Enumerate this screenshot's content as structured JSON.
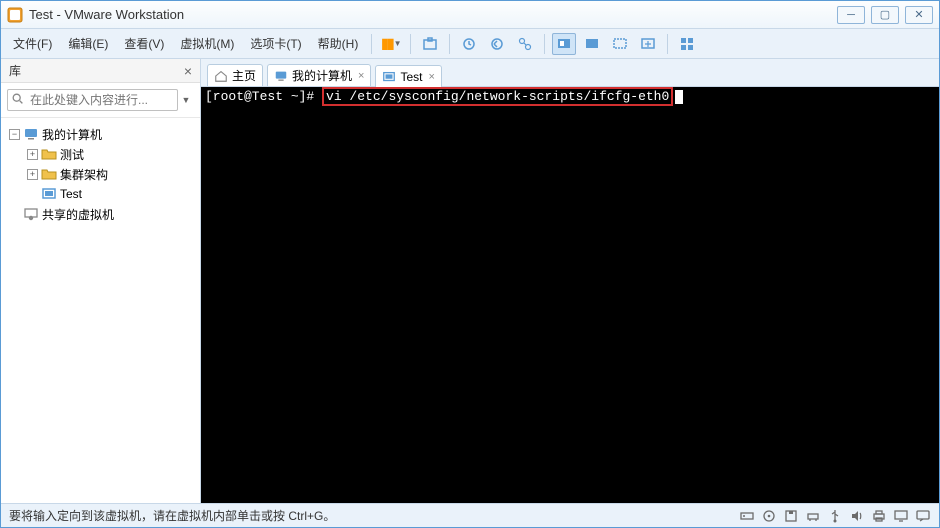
{
  "window": {
    "title": "Test - VMware Workstation"
  },
  "menu": {
    "file": "文件(F)",
    "edit": "编辑(E)",
    "view": "查看(V)",
    "vm": "虚拟机(M)",
    "tabs": "选项卡(T)",
    "help": "帮助(H)"
  },
  "sidebar": {
    "header": "库",
    "search_placeholder": "在此处键入内容进行...",
    "nodes": {
      "my_computer": "我的计算机",
      "test_folder": "测试",
      "cluster_folder": "集群架构",
      "test_vm": "Test",
      "shared_vms": "共享的虚拟机"
    }
  },
  "tabs": {
    "home": "主页",
    "my_computer": "我的计算机",
    "test": "Test"
  },
  "terminal": {
    "prompt": "[root@Test ~]# ",
    "command": "vi /etc/sysconfig/network-scripts/ifcfg-eth0"
  },
  "statusbar": {
    "message": "要将输入定向到该虚拟机，请在虚拟机内部单击或按 Ctrl+G。"
  }
}
